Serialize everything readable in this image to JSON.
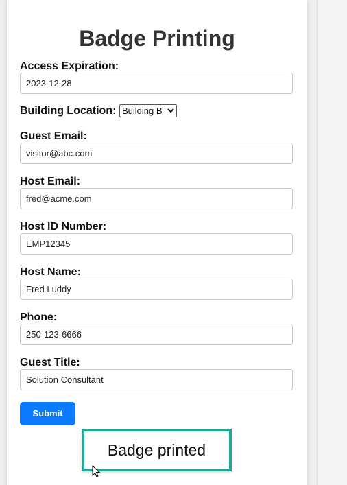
{
  "form": {
    "title": "Badge Printing",
    "access_expiration": {
      "label": "Access Expiration:",
      "value": "2023-12-28"
    },
    "building_location": {
      "label": "Building Location:",
      "selected": "Building B"
    },
    "guest_email": {
      "label": "Guest Email:",
      "value": "visitor@abc.com"
    },
    "host_email": {
      "label": "Host Email:",
      "value": "fred@acme.com"
    },
    "host_id": {
      "label": "Host ID Number:",
      "value": "EMP12345"
    },
    "host_name": {
      "label": "Host Name:",
      "value": "Fred Luddy"
    },
    "phone": {
      "label": "Phone:",
      "value": "250-123-6666"
    },
    "guest_title": {
      "label": "Guest Title:",
      "value": "Solution Consultant"
    },
    "submit_label": "Submit"
  },
  "toast": {
    "message": "Badge printed"
  },
  "colors": {
    "submit_button": "#0a7bff",
    "toast_border": "#1fa896"
  }
}
